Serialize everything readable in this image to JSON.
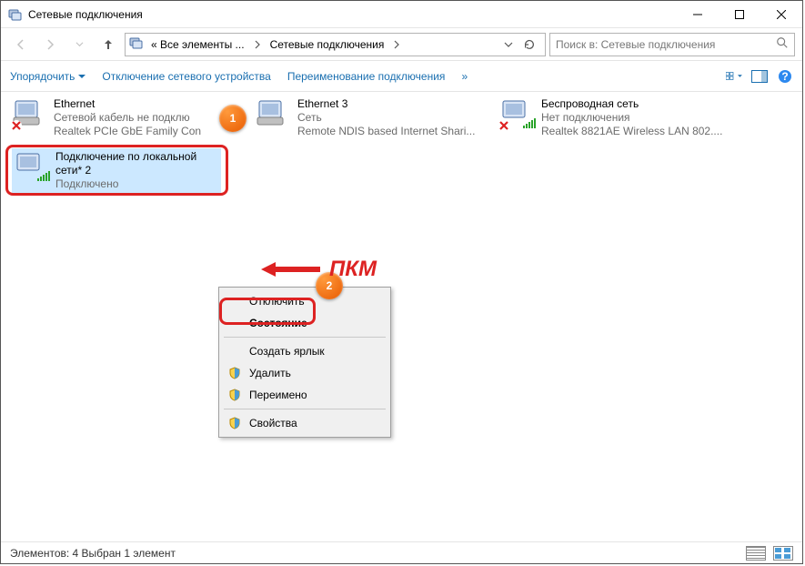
{
  "window": {
    "title": "Сетевые подключения"
  },
  "addressbar": {
    "crumb1": "« Все элементы ...",
    "crumb2": "Сетевые подключения"
  },
  "search": {
    "placeholder": "Поиск в: Сетевые подключения"
  },
  "toolbar": {
    "organize": "Упорядочить",
    "disable": "Отключение сетевого устройства",
    "rename": "Переименование подключения",
    "more": "»"
  },
  "connections": {
    "c1": {
      "name": "Ethernet",
      "line2": "Сетевой кабель не подклю",
      "line3": "Realtek PCIe GbE Family Con"
    },
    "c2": {
      "name": "Ethernet 3",
      "line2": "Сеть",
      "line3": "Remote NDIS based Internet Shari..."
    },
    "c3": {
      "name": "Беспроводная сеть",
      "line2": "Нет подключения",
      "line3": "Realtek 8821AE Wireless LAN 802...."
    },
    "c4": {
      "name": "Подключение по локальной сети* 2",
      "line3": "Подключено"
    }
  },
  "context_menu": {
    "disable": "Отключить",
    "status": "Состояние",
    "shortcut": "Создать ярлык",
    "delete": "Удалить",
    "rename": "Переимено",
    "properties": "Свойства"
  },
  "annotations": {
    "badge1": "1",
    "badge2": "2",
    "pkm": "ПКМ"
  },
  "statusbar": {
    "text": "Элементов: 4    Выбран 1 элемент"
  }
}
